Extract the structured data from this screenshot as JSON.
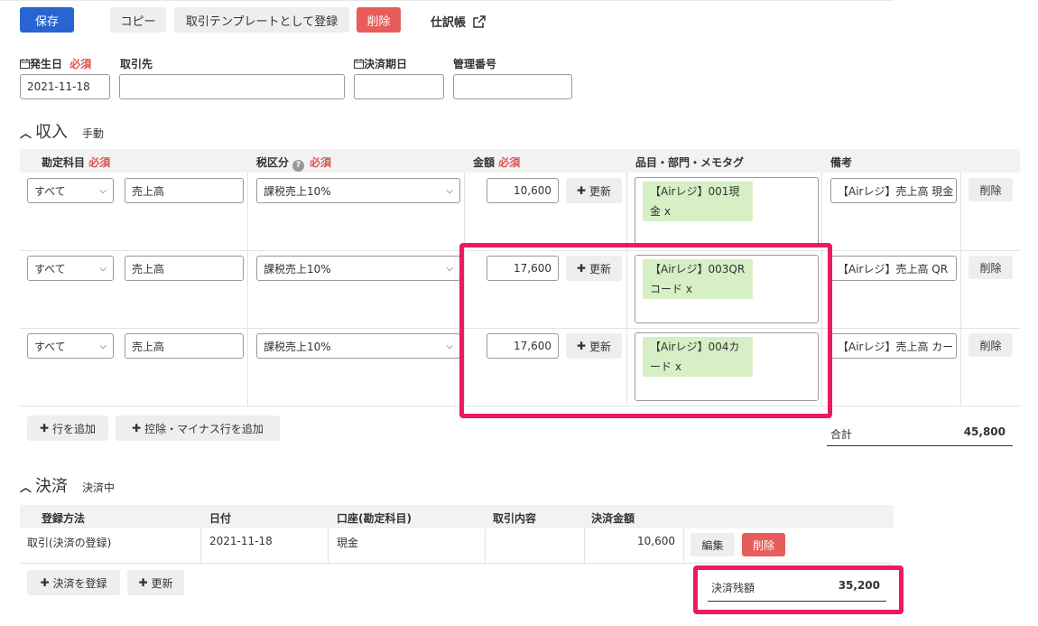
{
  "toolbar": {
    "save": "保存",
    "copy": "コピー",
    "register_template": "取引テンプレートとして登録",
    "delete": "削除",
    "journal": "仕訳帳"
  },
  "header_fields": {
    "issue_date_label": "発生日",
    "required": "必須",
    "issue_date_value": "2021-11-18",
    "partner_label": "取引先",
    "partner_value": "",
    "due_date_label": "決済期日",
    "due_date_value": "",
    "manage_no_label": "管理番号",
    "manage_no_value": ""
  },
  "income": {
    "title": "収入",
    "mode": "手動",
    "columns": {
      "account": "勘定科目",
      "tax": "税区分",
      "amount": "金額",
      "tags": "品目・部門・メモタグ",
      "notes": "備考"
    },
    "required": "必須",
    "rows": [
      {
        "filter": "すべて",
        "account": "売上高",
        "tax": "課税売上10%",
        "amount": "10,600",
        "update": "更新",
        "tag": "【Airレジ】001現金 x",
        "tag_l1": "【Airレジ】001現",
        "tag_l2": "金 x",
        "note": "【Airレジ】売上高 現金",
        "delete": "削除"
      },
      {
        "filter": "すべて",
        "account": "売上高",
        "tax": "課税売上10%",
        "amount": "17,600",
        "update": "更新",
        "tag": "【Airレジ】003QRコード x",
        "tag_l1": "【Airレジ】003QR",
        "tag_l2": "コード x",
        "note": "【Airレジ】売上高 QR",
        "delete": "削除"
      },
      {
        "filter": "すべて",
        "account": "売上高",
        "tax": "課税売上10%",
        "amount": "17,600",
        "update": "更新",
        "tag": "【Airレジ】004カード x",
        "tag_l1": "【Airレジ】004カ",
        "tag_l2": "ード x",
        "note": "【Airレジ】売上高 カー",
        "delete": "削除"
      }
    ],
    "add_row": "行を追加",
    "add_minus_row": "控除・マイナス行を追加",
    "total_label": "合計",
    "total_value": "45,800"
  },
  "payment": {
    "title": "決済",
    "status": "決済中",
    "columns": {
      "method": "登録方法",
      "date": "日付",
      "account": "口座(勘定科目)",
      "content": "取引内容",
      "amount": "決済金額"
    },
    "rows": [
      {
        "method": "取引(決済の登録)",
        "date": "2021-11-18",
        "account": "現金",
        "content": "",
        "amount": "10,600",
        "edit": "編集",
        "delete": "削除"
      }
    ],
    "register": "決済を登録",
    "update": "更新",
    "balance_label": "決済残額",
    "balance_value": "35,200"
  },
  "colors": {
    "primary": "#2864d2",
    "danger": "#e85c5c",
    "highlight": "#ec1a63",
    "tag_bg": "#d6efc5"
  }
}
